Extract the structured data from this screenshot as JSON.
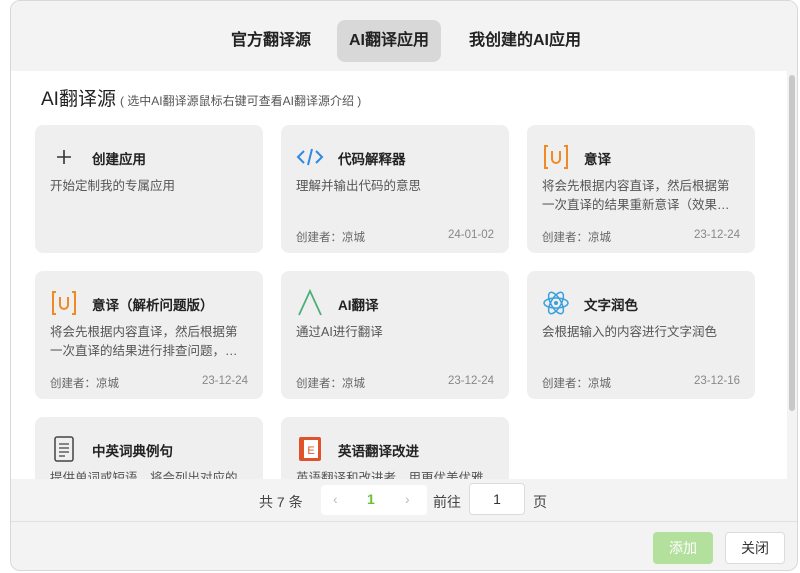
{
  "tabs": [
    {
      "label": "官方翻译源",
      "active": false
    },
    {
      "label": "AI翻译应用",
      "active": true
    },
    {
      "label": "我创建的AI应用",
      "active": false
    }
  ],
  "section": {
    "title": "AI翻译源",
    "hint": "( 选中AI翻译源鼠标右键可查看AI翻译源介绍 )"
  },
  "cards": [
    {
      "name": "创建应用",
      "desc": "开始定制我的专属应用",
      "author": "",
      "date": "",
      "icon": "plus-icon"
    },
    {
      "name": "代码解释器",
      "desc": "理解并输出代码的意思",
      "author": "创建者：凉城",
      "date": "24-01-02",
      "icon": "code-icon"
    },
    {
      "name": "意译",
      "desc": "将会先根据内容直译，然后根据第一次直译的结果重新意译（效果很好）",
      "author": "创建者：凉城",
      "date": "23-12-24",
      "icon": "u-bracket-icon"
    },
    {
      "name": "意译（解析问题版）",
      "desc": "将会先根据内容直译，然后根据第一次直译的结果进行排查问题，然后再根据问题进行意译",
      "author": "创建者：凉城",
      "date": "23-12-24",
      "icon": "u-bracket-icon"
    },
    {
      "name": "AI翻译",
      "desc": "通过AI进行翻译",
      "author": "创建者：凉城",
      "date": "23-12-24",
      "icon": "lambda-icon"
    },
    {
      "name": "文字润色",
      "desc": "会根据输入的内容进行文字润色",
      "author": "创建者：凉城",
      "date": "23-12-16",
      "icon": "atom-icon"
    },
    {
      "name": "中英词典例句",
      "desc": "提供单词或短语，将会列出对应的语",
      "author": "",
      "date": "",
      "icon": "document-icon"
    },
    {
      "name": "英语翻译改进",
      "desc": "英语翻译和改进者，用更优美优雅的",
      "author": "",
      "date": "",
      "icon": "book-e-icon"
    }
  ],
  "pagination": {
    "total": "共 7 条",
    "prev": "‹",
    "current": "1",
    "next": "›",
    "goto_label": "前往",
    "goto_value": "1",
    "page_label": "页"
  },
  "buttons": {
    "add": "添加",
    "close": "关闭"
  },
  "colors": {
    "accent": "#67c23a",
    "add_button": "#b3e19d",
    "code_icon": "#2f88e6",
    "u_icon": "#f08a24",
    "lambda_icon": "#4caf7a",
    "atom_icon": "#3a9fdc",
    "book_icon": "#e0522a"
  }
}
